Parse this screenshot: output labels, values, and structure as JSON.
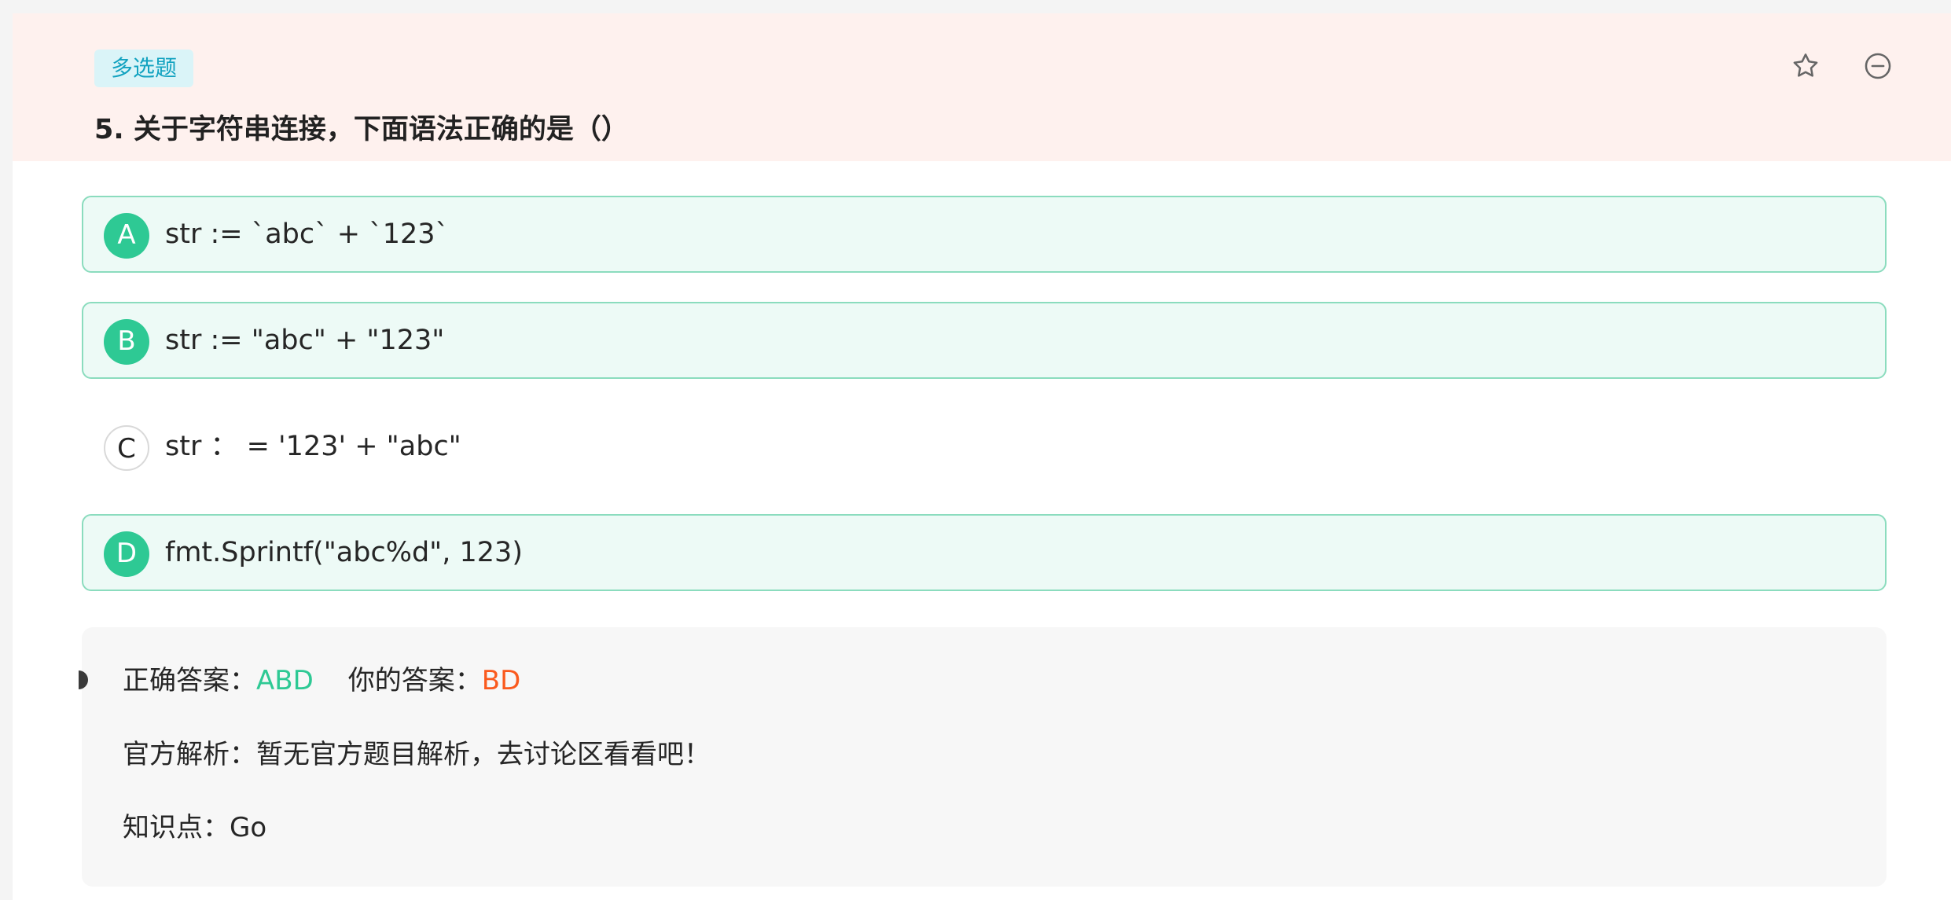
{
  "header": {
    "tag": "多选题",
    "question_number": "5.",
    "question_text": "关于字符串连接，下面语法正确的是（）",
    "star_icon": "star-icon",
    "minus_icon": "minus-circle-icon"
  },
  "options": [
    {
      "letter": "A",
      "text": "str := `abc` + `123`",
      "selected": true
    },
    {
      "letter": "B",
      "text": "str := \"abc\" + \"123\"",
      "selected": true
    },
    {
      "letter": "C",
      "text": "str ： = '123' + \"abc\"",
      "selected": false
    },
    {
      "letter": "D",
      "text": "fmt.Sprintf(\"abc%d\", 123)",
      "selected": true
    }
  ],
  "analysis": {
    "correct_label": "正确答案：",
    "correct_value": "ABD",
    "your_label": "你的答案：",
    "your_value": "BD",
    "explanation_label": "官方解析：",
    "explanation_text": "暂无官方题目解析，去讨论区看看吧！",
    "knowledge_label": "知识点：",
    "knowledge_value": "Go"
  },
  "colors": {
    "header_bg": "#fef1ee",
    "tag_bg": "#daf4f8",
    "tag_text": "#12a2c0",
    "selected_bg": "#edfaf6",
    "selected_border": "#8bdcbe",
    "accent_green": "#2ec994",
    "accent_orange": "#fa5a1e",
    "analysis_bg": "#f7f7f7"
  }
}
